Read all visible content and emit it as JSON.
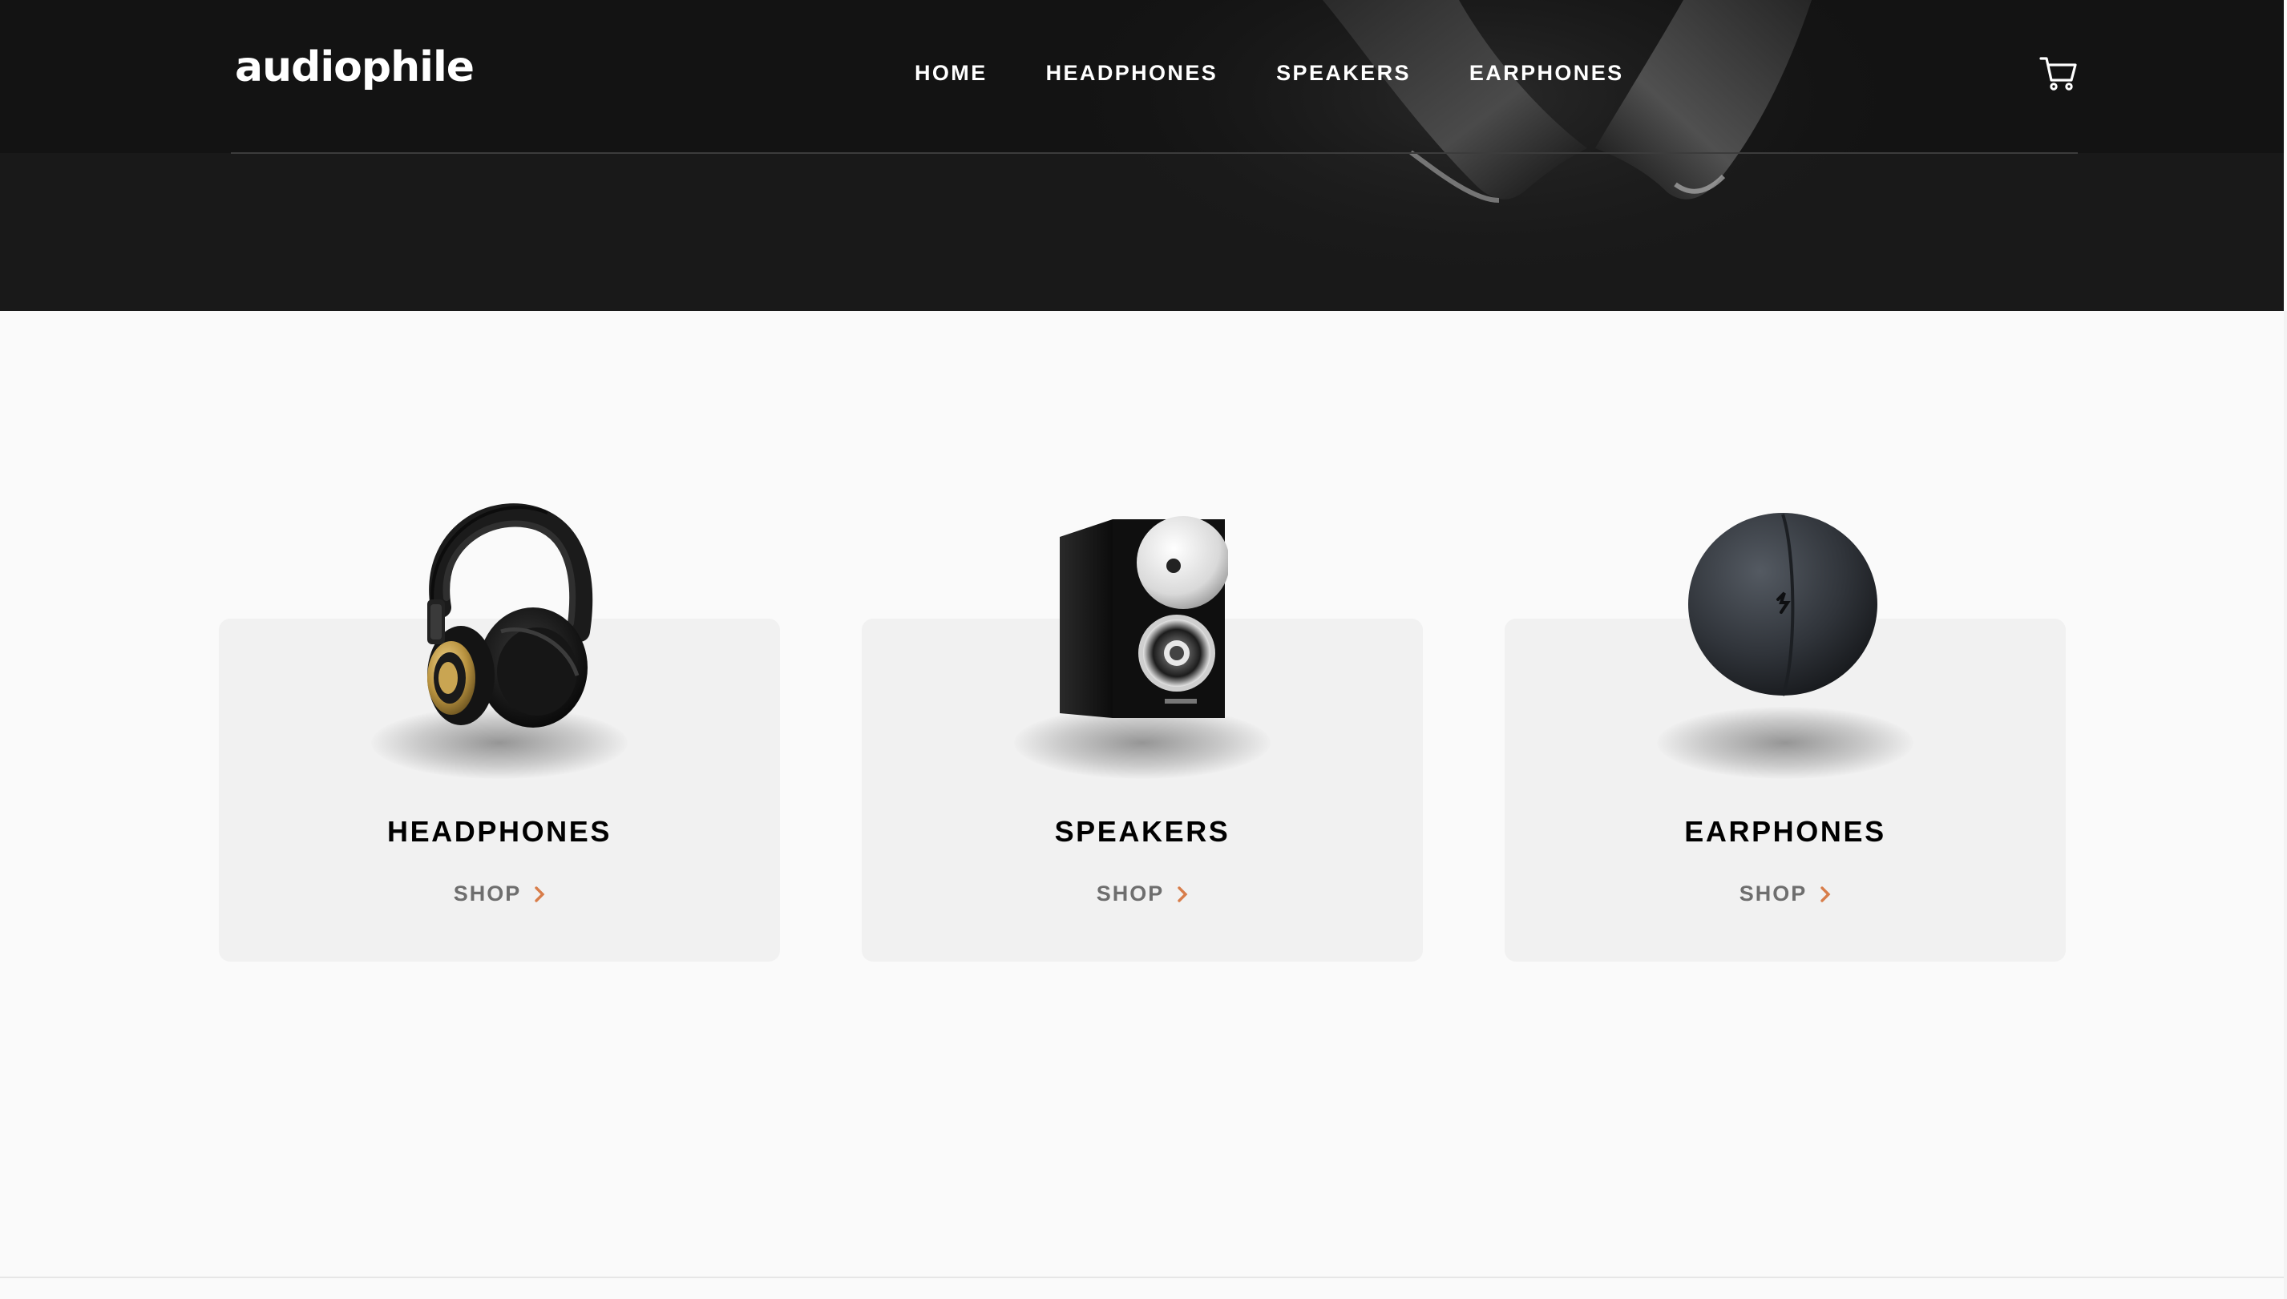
{
  "header": {
    "logo": "audiophile",
    "nav": [
      "HOME",
      "HEADPHONES",
      "SPEAKERS",
      "EARPHONES"
    ],
    "cart_icon": "cart-icon"
  },
  "categories": [
    {
      "title": "HEADPHONES",
      "shop_label": "SHOP",
      "icon": "chevron-right-icon",
      "image": "headphones-image"
    },
    {
      "title": "SPEAKERS",
      "shop_label": "SHOP",
      "icon": "chevron-right-icon",
      "image": "speaker-image"
    },
    {
      "title": "EARPHONES",
      "shop_label": "SHOP",
      "icon": "chevron-right-icon",
      "image": "earphones-case-image"
    }
  ],
  "colors": {
    "header_bg": "#131313",
    "hero_bg": "#191919",
    "page_bg": "#fafafa",
    "card_bg": "#f1f1f1",
    "accent": "#d87d4a",
    "shop_text": "#6e6e6e"
  }
}
